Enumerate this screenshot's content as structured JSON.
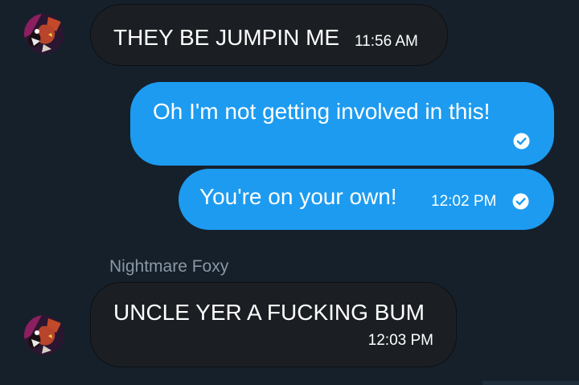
{
  "conversation": {
    "messages": [
      {
        "direction": "incoming",
        "text": "THEY BE JUMPIN ME",
        "time": "11:56 AM"
      },
      {
        "direction": "outgoing",
        "text": "Oh I'm not getting involved in this!",
        "time": "",
        "status_icon": "read-check-icon"
      },
      {
        "direction": "outgoing",
        "text": "You're on your own!",
        "time": "12:02 PM",
        "status_icon": "read-check-icon"
      },
      {
        "direction": "incoming",
        "sender": "Nightmare Foxy",
        "text": "UNCLE YER A FUCKING BUM",
        "time": "12:03 PM"
      }
    ],
    "avatar_icon": "foxy-avatar-icon"
  },
  "colors": {
    "background": "#15202b",
    "incoming_bubble": "#1b1f23",
    "outgoing_bubble": "#1d9bf0",
    "sender_name": "#8b98a5",
    "text": "#ffffff"
  }
}
